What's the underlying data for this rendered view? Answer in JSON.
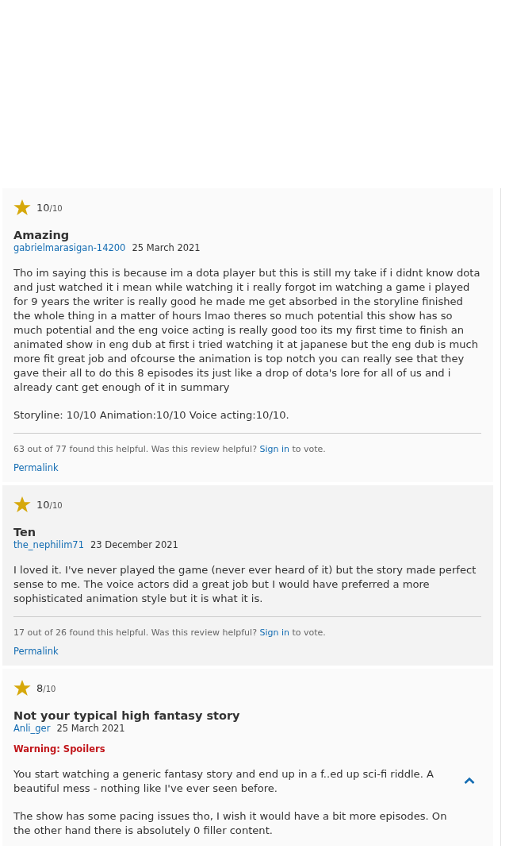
{
  "reviews": [
    {
      "rating": "10",
      "scale": "/10",
      "title": "Amazing",
      "author": "gabrielmarasigan-14200",
      "date": "25 March 2021",
      "paragraphs": [
        "Tho im saying this is because im a dota player but this is still my take if i didnt know dota and just watched it i mean while watching it i really forgot im watching a game i played for 9 years the writer is really good he made me get absorbed in the storyline finished the whole thing in a matter of hours lmao theres so much potential this show has so much potential and the eng voice acting is really good too its my first time to finish an animated show in eng dub at first i tried watching it at japanese but the eng dub is much more fit great job and ofcourse the animation is top notch you can really see that they gave their all to do this 8 episodes its just like a drop of dota's lore for all of us and i already cant get enough of it in summary",
        "Storyline: 10/10 Animation:10/10 Voice acting:10/10."
      ],
      "helpful": {
        "text": "63 out of 77 found this helpful. Was this review helpful?",
        "link": "Sign in",
        "suffix": "to vote."
      },
      "permalink": "Permalink"
    },
    {
      "rating": "10",
      "scale": "/10",
      "title": "Ten",
      "author": "the_nephilim71",
      "date": "23 December 2021",
      "paragraphs": [
        "I loved it. I've never played the game (never ever heard of it) but the story made perfect sense to me. The voice actors did a great job but I would have preferred a more sophisticated animation style but it is what it is."
      ],
      "helpful": {
        "text": "17 out of 26 found this helpful. Was this review helpful?",
        "link": "Sign in",
        "suffix": "to vote."
      },
      "permalink": "Permalink"
    },
    {
      "rating": "8",
      "scale": "/10",
      "title": "Not your typical high fantasy story",
      "author": "Anli_ger",
      "date": "25 March 2021",
      "spoiler_warning": "Warning: Spoilers",
      "expanded": true,
      "paragraphs": [
        "You start watching a generic fantasy story and end up in a f..ed up sci-fi riddle. A beautiful mess - nothing like I've ever seen before.",
        "The show has some pacing issues tho, I wish it would have a bit more episodes. On the other hand there is absolutely 0 filler content."
      ]
    }
  ]
}
